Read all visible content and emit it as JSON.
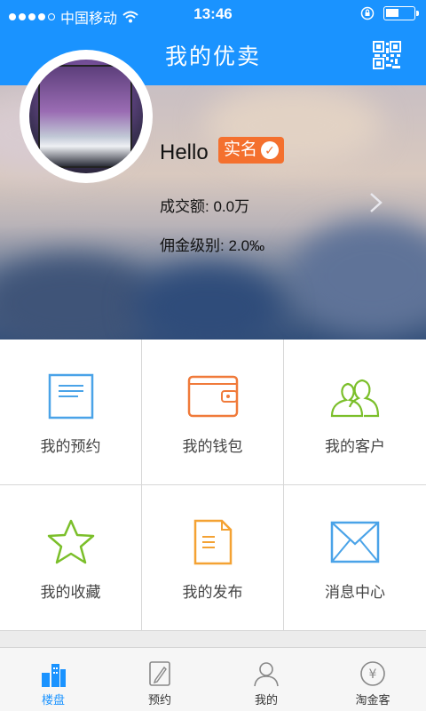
{
  "status_bar": {
    "carrier": "中国移动",
    "time": "13:46",
    "signal_dots": 5,
    "signal_filled": 4
  },
  "nav": {
    "title": "我的优卖",
    "qr_icon": "qr-code-icon"
  },
  "profile": {
    "greeting": "Hello",
    "verified_badge": "实名",
    "turnover_label": "成交额:",
    "turnover_value": "0.0万",
    "commission_label": "佣金级别:",
    "commission_value": "2.0‰"
  },
  "menu": [
    {
      "label": "我的预约",
      "icon": "notebook-icon",
      "color": "#4aa3e8"
    },
    {
      "label": "我的钱包",
      "icon": "wallet-icon",
      "color": "#f07a3a"
    },
    {
      "label": "我的客户",
      "icon": "customers-icon",
      "color": "#7bbf2a"
    },
    {
      "label": "我的收藏",
      "icon": "star-icon",
      "color": "#7bbf2a"
    },
    {
      "label": "我的发布",
      "icon": "document-icon",
      "color": "#f4a233"
    },
    {
      "label": "消息中心",
      "icon": "envelope-icon",
      "color": "#4aa3e8"
    }
  ],
  "tabbar": {
    "active_color": "#1a93ff",
    "items": [
      {
        "label": "楼盘",
        "icon": "buildings-icon",
        "active": true
      },
      {
        "label": "预约",
        "icon": "pencil-note-icon",
        "active": false
      },
      {
        "label": "我的",
        "icon": "person-icon",
        "active": false
      },
      {
        "label": "淘金客",
        "icon": "yen-coin-icon",
        "active": false
      }
    ]
  },
  "colors": {
    "primary": "#1a93ff",
    "badge": "#f4702e"
  }
}
